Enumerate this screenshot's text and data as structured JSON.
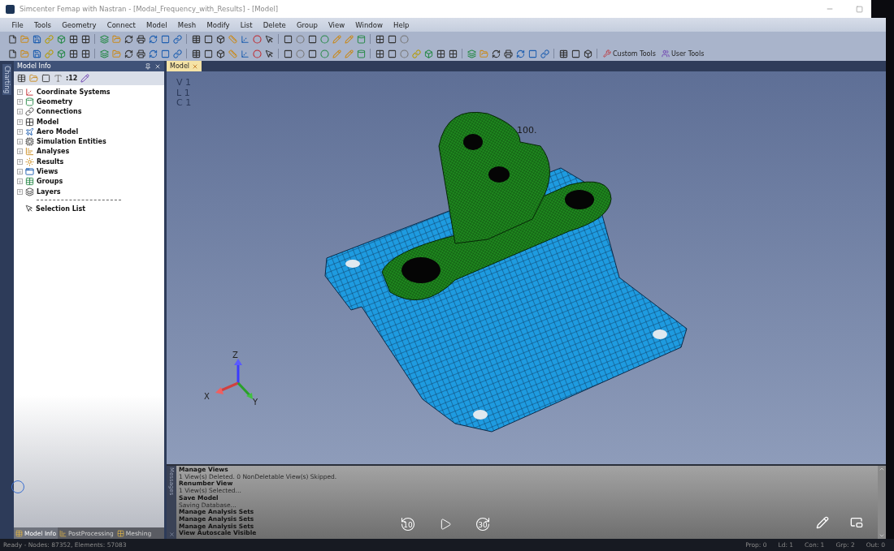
{
  "window": {
    "title": "Simcenter Femap with Nastran - [Modal_Frequency_with_Results] - [Model]"
  },
  "menu": [
    "File",
    "Tools",
    "Geometry",
    "Connect",
    "Model",
    "Mesh",
    "Modify",
    "List",
    "Delete",
    "Group",
    "View",
    "Window",
    "Help"
  ],
  "toolbar": {
    "custom_tools": "Custom Tools",
    "user_tools": "User Tools"
  },
  "side_strip": {
    "label": "Charting"
  },
  "model_info": {
    "title": "Model Info",
    "toolbar_count": ":12",
    "tree": [
      {
        "label": "Coordinate Systems",
        "expanded": false
      },
      {
        "label": "Geometry",
        "expanded": false
      },
      {
        "label": "Connections",
        "expanded": false
      },
      {
        "label": "Model",
        "expanded": false
      },
      {
        "label": "Aero Model",
        "expanded": false
      },
      {
        "label": "Simulation Entities",
        "expanded": false
      },
      {
        "label": "Analyses",
        "expanded": false
      },
      {
        "label": "Results",
        "expanded": false
      },
      {
        "label": "Views",
        "expanded": false
      },
      {
        "label": "Groups",
        "expanded": false
      },
      {
        "label": "Layers",
        "expanded": false
      }
    ],
    "selection_list": "Selection List",
    "tabs": [
      {
        "label": "Model Info",
        "selected": true
      },
      {
        "label": "PostProcessing",
        "selected": false
      },
      {
        "label": "Meshing",
        "selected": false
      }
    ]
  },
  "viewport": {
    "tab": {
      "label": "Model",
      "selected": true
    },
    "info": [
      "V 1",
      "L 1",
      "C 1"
    ],
    "label": "100.",
    "axes": {
      "x": "X",
      "y": "Y",
      "z": "Z"
    }
  },
  "messages": {
    "title": "Messages",
    "lines": [
      {
        "text": "Manage Views",
        "kind": "command"
      },
      {
        "text": "1 View(s) Deleted. 0 NonDeletable View(s) Skipped.",
        "kind": "info"
      },
      {
        "text": "Renumber View",
        "kind": "command"
      },
      {
        "text": "1 View(s) Selected...",
        "kind": "info"
      },
      {
        "text": "Save Model",
        "kind": "command"
      },
      {
        "text": "Saving Database...",
        "kind": "info"
      },
      {
        "text": "Manage Analysis Sets",
        "kind": "command"
      },
      {
        "text": "Manage Analysis Sets",
        "kind": "command"
      },
      {
        "text": "Manage Analysis Sets",
        "kind": "command"
      },
      {
        "text": "View Autoscale Visible",
        "kind": "command"
      }
    ]
  },
  "player": {
    "rewind": "10",
    "forward": "30"
  },
  "status_bar": {
    "text": "Ready - Nodes: 87352, Elements: 57083",
    "fields": [
      "Prop: 0",
      "Ld: 1",
      "Con: 1",
      "Grp: 2",
      "Out: 0"
    ]
  }
}
